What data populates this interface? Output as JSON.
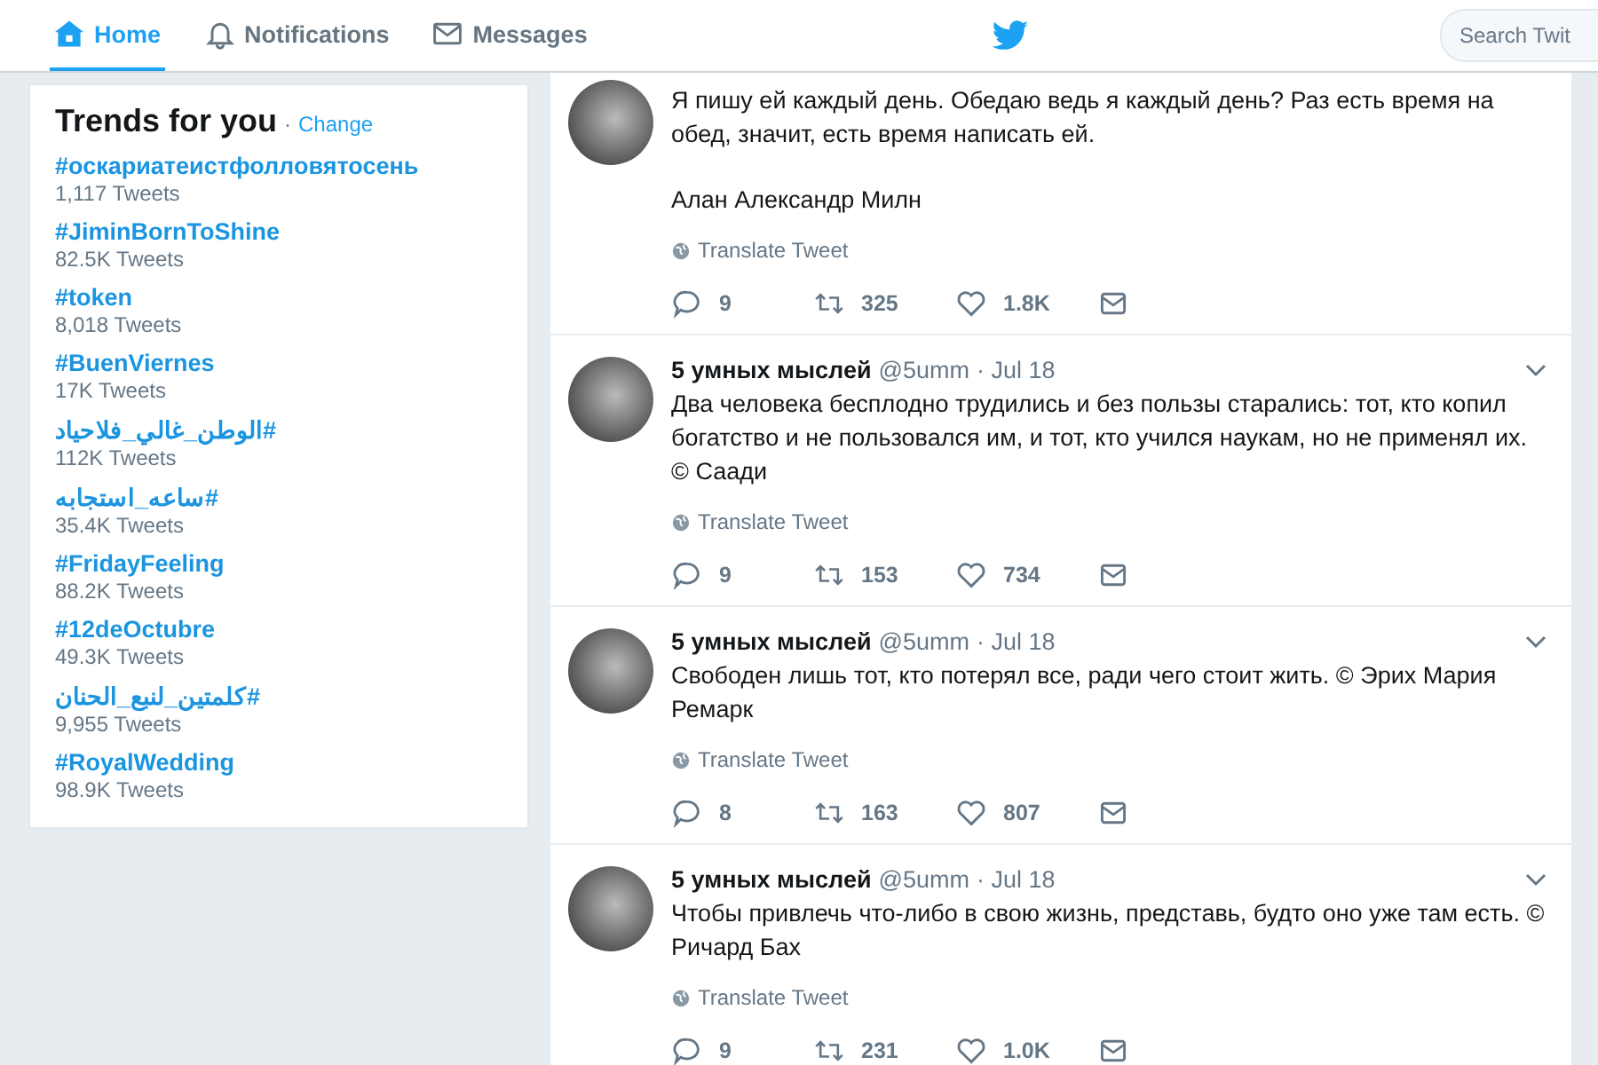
{
  "nav": {
    "tabs": [
      {
        "label": "Home",
        "selected": true
      },
      {
        "label": "Notifications",
        "selected": false
      },
      {
        "label": "Messages",
        "selected": false
      }
    ],
    "search": {
      "placeholder": "Search Twit"
    }
  },
  "trends": {
    "title": "Trends for you",
    "separator": "·",
    "change": "Change",
    "items": [
      {
        "tag": "#оскариатеистфолловятосень",
        "count": "1,117 Tweets"
      },
      {
        "tag": "#JiminBornToShine",
        "count": "82.5K Tweets"
      },
      {
        "tag": "#token",
        "count": "8,018 Tweets"
      },
      {
        "tag": "#BuenViernes",
        "count": "17K Tweets"
      },
      {
        "tag": "#الوطن_غالي_فلاحياد",
        "count": "112K Tweets"
      },
      {
        "tag": "#ساعه_استجابه",
        "count": "35.4K Tweets"
      },
      {
        "tag": "#FridayFeeling",
        "count": "88.2K Tweets"
      },
      {
        "tag": "#12deOctubre",
        "count": "49.3K Tweets"
      },
      {
        "tag": "#كلمتين_لنبع_الحنان",
        "count": "9,955 Tweets"
      },
      {
        "tag": "#RoyalWedding",
        "count": "98.9K Tweets"
      }
    ]
  },
  "tweets": [
    {
      "paragraphs": [
        "Я пишу ей каждый день. Обедаю ведь я каждый день? Раз есть время на обед, значит, есть время написать ей.",
        "Алан Александр Милн"
      ],
      "translate": "Translate Tweet",
      "replies": "9",
      "retweets": "325",
      "likes": "1.8K"
    },
    {
      "name": "5 умных мыслей",
      "handle": "@5umm",
      "date": "· Jul 18",
      "paragraphs": [
        "Два человека бесплодно трудились и без пользы старались: тот, кто копил богатство и не пользовался им, и тот, кто учился наукам, но не применял их. © Саади"
      ],
      "translate": "Translate Tweet",
      "replies": "9",
      "retweets": "153",
      "likes": "734"
    },
    {
      "name": "5 умных мыслей",
      "handle": "@5umm",
      "date": "· Jul 18",
      "paragraphs": [
        "Свободен лишь тот, кто потерял все, ради чего стоит жить. © Эрих Мария Ремарк"
      ],
      "translate": "Translate Tweet",
      "replies": "8",
      "retweets": "163",
      "likes": "807"
    },
    {
      "name": "5 умных мыслей",
      "handle": "@5umm",
      "date": "· Jul 18",
      "paragraphs": [
        "Чтобы привлечь что-либо в свою жизнь, представь, будто оно уже там есть. © Ричард Бах"
      ],
      "translate": "Translate Tweet",
      "replies": "9",
      "retweets": "231",
      "likes": "1.0K"
    }
  ]
}
